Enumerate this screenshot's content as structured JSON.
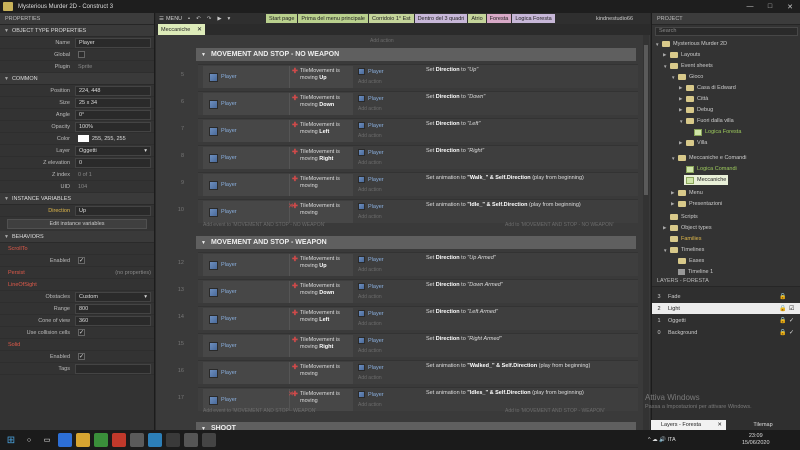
{
  "window": {
    "title": "Mysterious Murder 2D - Construct 3",
    "minimize": "—",
    "maximize": "□",
    "close": "✕"
  },
  "properties": {
    "header": "PROPERTIES",
    "object_type": {
      "section": "OBJECT TYPE PROPERTIES",
      "name_label": "Name",
      "name_value": "Player",
      "global_label": "Global",
      "plugin_label": "Plugin",
      "plugin_value": "Sprite"
    },
    "common": {
      "section": "COMMON",
      "position_label": "Position",
      "position_value": "224, 448",
      "size_label": "Size",
      "size_value": "25 x 34",
      "angle_label": "Angle",
      "angle_value": "0°",
      "opacity_label": "Opacity",
      "opacity_value": "100%",
      "color_label": "Color",
      "color_value": "255, 255, 255",
      "layer_label": "Layer",
      "layer_value": "Oggetti",
      "zelev_label": "Z elevation",
      "zelev_value": "0",
      "zindex_label": "Z index",
      "zindex_value": "0 of 1",
      "uid_label": "UID",
      "uid_value": "104"
    },
    "instance_vars": {
      "section": "INSTANCE VARIABLES",
      "direction_label": "Direction",
      "direction_value": "Up",
      "edit_button": "Edit instance variables"
    },
    "behaviors": {
      "section": "BEHAVIORS",
      "scrollto": "ScrollTo",
      "scrollto_enabled_label": "Enabled",
      "persist": "Persist",
      "persist_value": "(no properties)",
      "los": "LineOfSight",
      "obstacles_label": "Obstacles",
      "obstacles_value": "Custom",
      "range_label": "Range",
      "range_value": "800",
      "cone_label": "Cone of view",
      "cone_value": "360",
      "collision_label": "Use collision cells",
      "solid": "Solid",
      "solid_enabled_label": "Enabled",
      "tags_label": "Tags"
    }
  },
  "toolbar": {
    "menu": "MENU",
    "save_icon": "save-icon",
    "undo": "↶",
    "redo": "↷",
    "play": "▶",
    "dropdown": "▾",
    "user": "kindnestudio66"
  },
  "tabs": [
    {
      "label": "Start page",
      "color": "#b9d08d"
    },
    {
      "label": "Prima del menu principale",
      "color": "#b9d08d"
    },
    {
      "label": "Corridoio 1° Est",
      "color": "#c4d49a"
    },
    {
      "label": "Dentro del 3 quadri",
      "color": "#c7b7d8"
    },
    {
      "label": "Atrio",
      "color": "#c4d49a"
    },
    {
      "label": "Foresta",
      "color": "#d8a9c7"
    },
    {
      "label": "Logica Foresta",
      "color": "#c7b7d8"
    }
  ],
  "active_doc": {
    "label": "Meccaniche",
    "close": "✕"
  },
  "sheet": {
    "add_action": "Add action",
    "group1": {
      "title": "MOVEMENT AND STOP - NO WEAPON",
      "add_event_to": "Add event to 'MOVEMENT AND STOP - NO WEAPON'",
      "add_to": "Add to 'MOVEMENT AND STOP - NO WEAPON'"
    },
    "group2": {
      "title": "MOVEMENT AND STOP - WEAPON",
      "add_event_to": "Add event to 'MOVEMENT AND STOP - WEAPON'",
      "add_to": "Add to 'MOVEMENT AND STOP - WEAPON'"
    },
    "group3": {
      "title": "SHOOT"
    },
    "events_group1": [
      {
        "num": "5",
        "obj": "Player",
        "cond_pre": "TileMovement is moving",
        "cond_bold": "Up",
        "act_obj": "Player",
        "act_pre": "Set",
        "act_bold": "Direction",
        "act_mid": "to",
        "act_arg": "\"Up\"",
        "act_post": ""
      },
      {
        "num": "6",
        "obj": "Player",
        "cond_pre": "TileMovement is moving",
        "cond_bold": "Down",
        "act_obj": "Player",
        "act_pre": "Set",
        "act_bold": "Direction",
        "act_mid": "to",
        "act_arg": "\"Down\"",
        "act_post": ""
      },
      {
        "num": "7",
        "obj": "Player",
        "cond_pre": "TileMovement is moving",
        "cond_bold": "Left",
        "act_obj": "Player",
        "act_pre": "Set",
        "act_bold": "Direction",
        "act_mid": "to",
        "act_arg": "\"Left\"",
        "act_post": ""
      },
      {
        "num": "8",
        "obj": "Player",
        "cond_pre": "TileMovement is moving",
        "cond_bold": "Right",
        "act_obj": "Player",
        "act_pre": "Set",
        "act_bold": "Direction",
        "act_mid": "to",
        "act_arg": "\"Right\"",
        "act_post": ""
      },
      {
        "num": "9",
        "obj": "Player",
        "cond_pre": "TileMovement is moving",
        "cond_bold": "",
        "act_obj": "Player",
        "act_pre": "Set animation to",
        "act_bold": "\"Walk_\" & Self.Direction",
        "act_mid": "",
        "act_arg": "",
        "act_post": "(play from beginning)"
      },
      {
        "num": "10",
        "obj": "Player",
        "cond_pre": "TileMovement is moving",
        "cond_bold": "",
        "act_obj": "Player",
        "act_pre": "Set animation to",
        "act_bold": "\"Idle_\" & Self.Direction",
        "act_mid": "",
        "act_arg": "",
        "act_post": "(play from beginning)"
      }
    ],
    "events_group2": [
      {
        "num": "12",
        "obj": "Player",
        "cond_pre": "TileMovement is moving",
        "cond_bold": "Up",
        "act_obj": "Player",
        "act_pre": "Set",
        "act_bold": "Direction",
        "act_mid": "to",
        "act_arg": "\"Up Armed\"",
        "act_post": ""
      },
      {
        "num": "13",
        "obj": "Player",
        "cond_pre": "TileMovement is moving",
        "cond_bold": "Down",
        "act_obj": "Player",
        "act_pre": "Set",
        "act_bold": "Direction",
        "act_mid": "to",
        "act_arg": "\"Down Armed\"",
        "act_post": ""
      },
      {
        "num": "14",
        "obj": "Player",
        "cond_pre": "TileMovement is moving",
        "cond_bold": "Left",
        "act_obj": "Player",
        "act_pre": "Set",
        "act_bold": "Direction",
        "act_mid": "to",
        "act_arg": "\"Left Armed\"",
        "act_post": ""
      },
      {
        "num": "15",
        "obj": "Player",
        "cond_pre": "TileMovement is moving",
        "cond_bold": "Right",
        "act_obj": "Player",
        "act_pre": "Set",
        "act_bold": "Direction",
        "act_mid": "to",
        "act_arg": "\"Right Armed\"",
        "act_post": ""
      },
      {
        "num": "16",
        "obj": "Player",
        "cond_pre": "TileMovement is moving",
        "cond_bold": "",
        "act_obj": "Player",
        "act_pre": "Set animation to",
        "act_bold": "\"Walked_\" & Self.Direction",
        "act_mid": "",
        "act_arg": "",
        "act_post": "(play from beginning)"
      },
      {
        "num": "17",
        "obj": "Player",
        "cond_pre": "TileMovement is moving",
        "cond_bold": "",
        "act_obj": "Player",
        "act_pre": "Set animation to",
        "act_bold": "\"Idles_\" & Self.Direction",
        "act_mid": "",
        "act_arg": "",
        "act_post": "(play from beginning)"
      }
    ]
  },
  "project": {
    "header": "PROJECT",
    "search_placeholder": "Search",
    "items": {
      "root": "Mysterious Murder 2D",
      "layouts": "Layouts",
      "event_sheets": "Event sheets",
      "gioco": "Gioco",
      "casa": "Casa di Edward",
      "citta": "Città",
      "debug": "Debug",
      "fuori": "Fuori dalla villa",
      "logica_foresta": "Logica Foresta",
      "villa": "Villa",
      "meccaniche_comandi": "Meccaniche e Comandi",
      "logica_comandi": "Logica Comandi",
      "meccaniche": "Meccaniche",
      "menu": "Menu",
      "presentazioni": "Presentazioni",
      "scripts": "Scripts",
      "object_types": "Object types",
      "families": "Families",
      "timelines": "Timelines",
      "eases": "Eases",
      "timeline1": "Timeline 1"
    }
  },
  "layers": {
    "header": "LAYERS - FORESTA",
    "rows": [
      {
        "num": "3",
        "name": "Fade",
        "lock": "🔒",
        "vis": ""
      },
      {
        "num": "2",
        "name": "Light",
        "lock": "🔒",
        "vis": "☑"
      },
      {
        "num": "1",
        "name": "Oggetti",
        "lock": "🔒",
        "vis": "✓"
      },
      {
        "num": "0",
        "name": "Background",
        "lock": "🔒",
        "vis": "✓"
      }
    ]
  },
  "watermark": {
    "line1": "Attiva Windows",
    "line2": "Passa a Impostazioni per attivare Windows."
  },
  "bottom_tabs": {
    "layers": "Layers - Foresta",
    "close": "✕",
    "tilemap": "Tilemap"
  },
  "taskbar": {
    "tray": "^  ☁  🔊  ITA",
    "time": "23:09",
    "date": "15/06/2020"
  }
}
